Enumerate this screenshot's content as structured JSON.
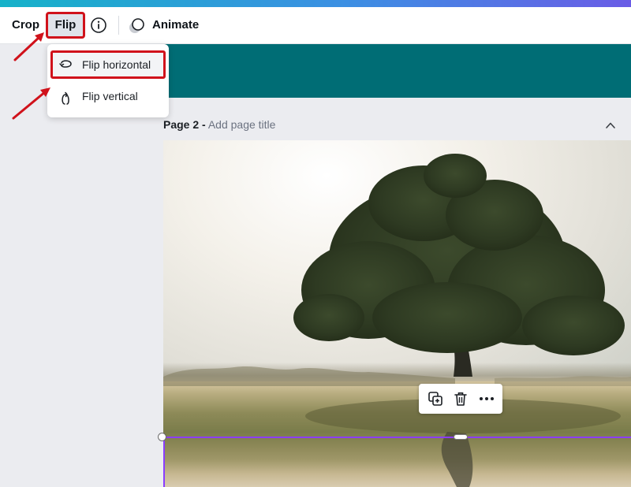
{
  "toolbar": {
    "crop_label": "Crop",
    "flip_label": "Flip",
    "info_icon": "info-icon",
    "animate_icon": "animate-icon",
    "animate_label": "Animate"
  },
  "flip_menu": {
    "items": [
      {
        "label": "Flip horizontal",
        "icon": "flip-horizontal-icon",
        "highlighted": true
      },
      {
        "label": "Flip vertical",
        "icon": "flip-vertical-icon",
        "highlighted": false
      }
    ]
  },
  "page": {
    "number_label": "Page 2 -",
    "title_placeholder": "Add page title"
  },
  "element_toolbar": {
    "icons": [
      "duplicate-icon",
      "trash-icon",
      "more-icon"
    ]
  },
  "colors": {
    "annotation_red": "#d0121b",
    "banner_teal": "#006d75",
    "selection_purple": "#8b3dff",
    "gradient_start": "#16b2c9",
    "gradient_end": "#6a5ce6"
  }
}
